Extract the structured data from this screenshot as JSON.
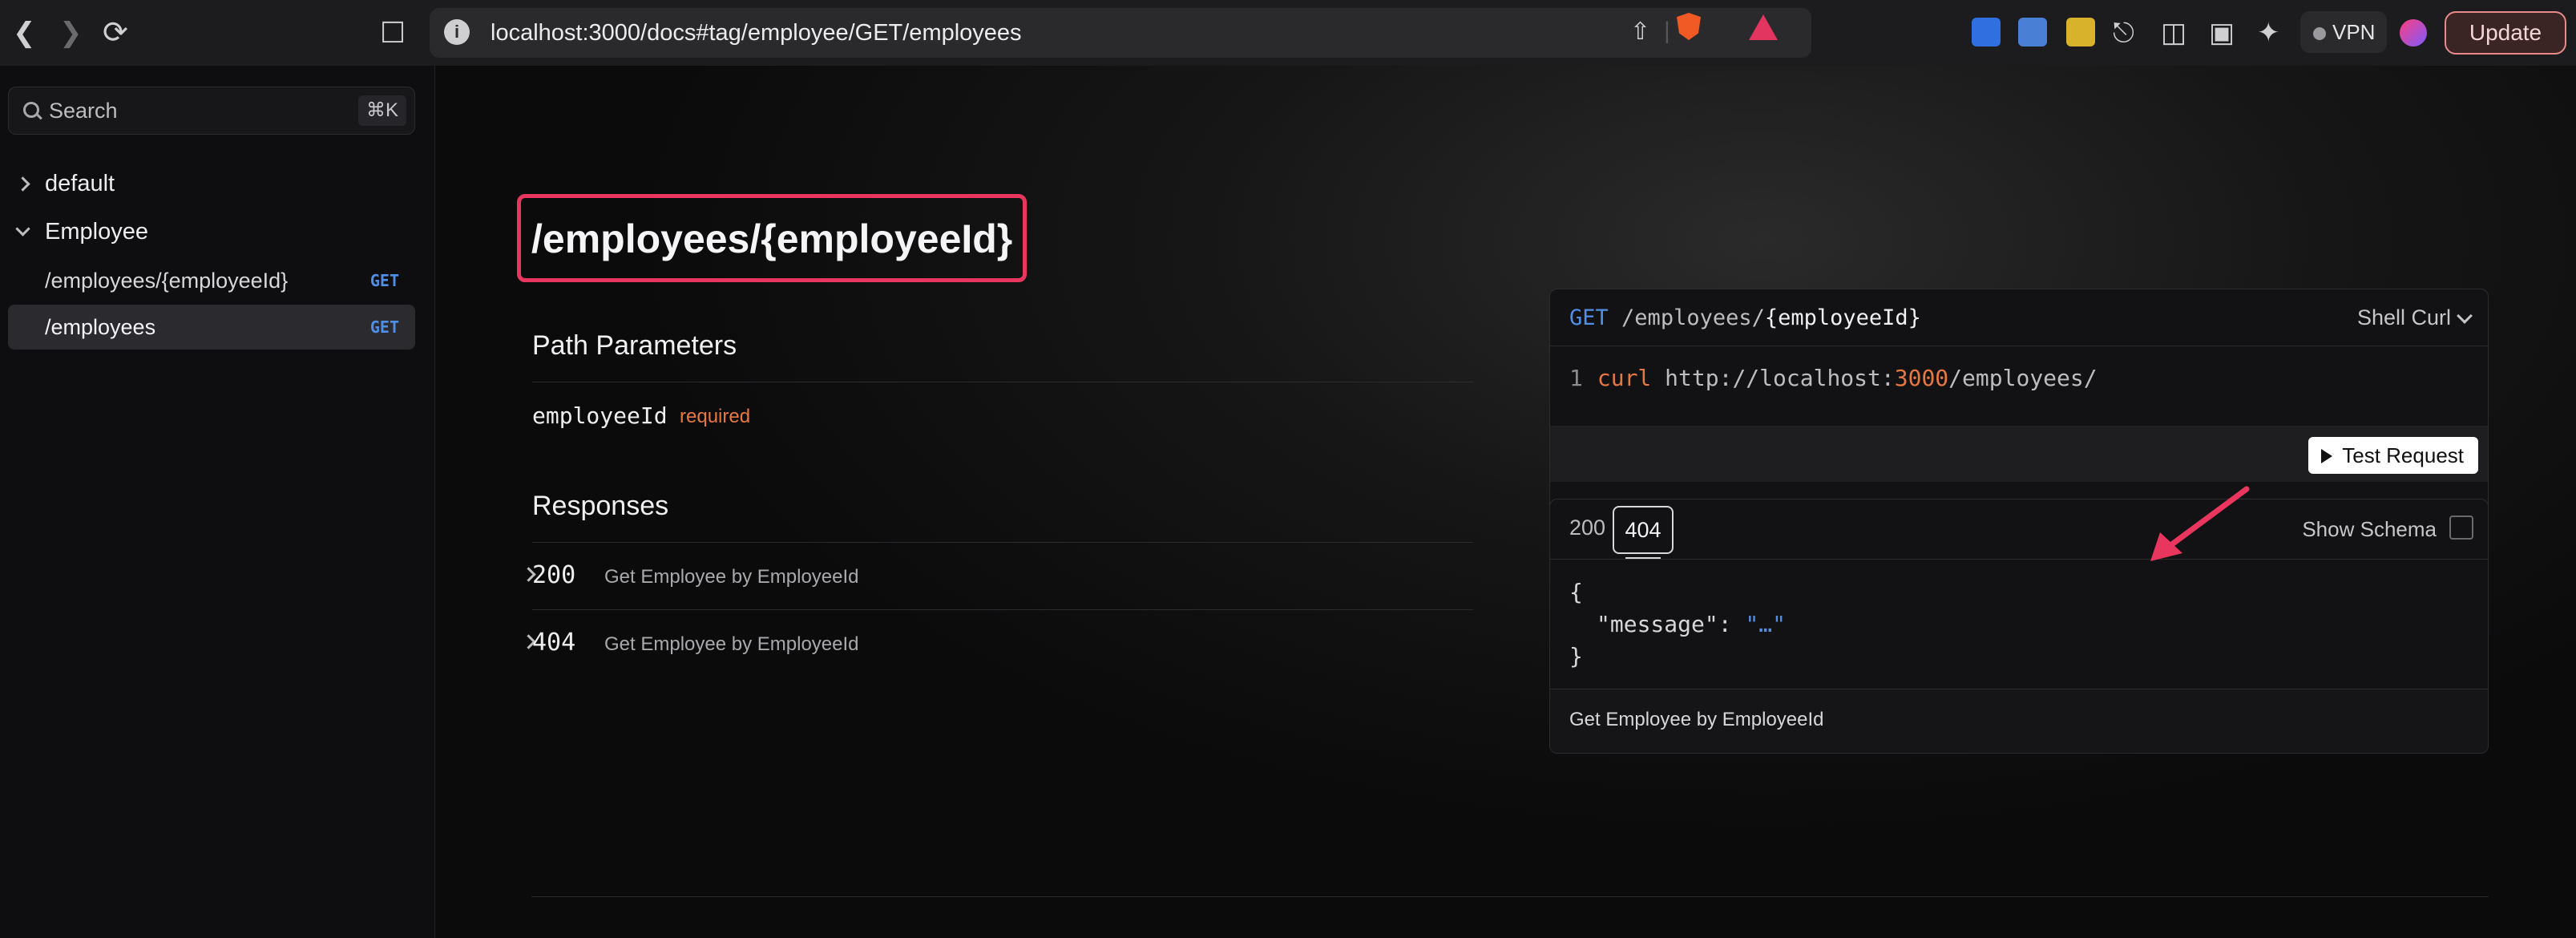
{
  "browser": {
    "url": "localhost:3000/docs#tag/employee/GET/employees",
    "vpn_label": "VPN",
    "update_label": "Update"
  },
  "sidebar": {
    "search_placeholder": "Search",
    "search_shortcut": "⌘K",
    "groups": [
      {
        "label": "default",
        "expanded": false
      },
      {
        "label": "Employee",
        "expanded": true
      }
    ],
    "items": [
      {
        "label": "/employees/{employeeId}",
        "method": "GET",
        "active": false
      },
      {
        "label": "/employees",
        "method": "GET",
        "active": true
      }
    ]
  },
  "main": {
    "title": "/employees/{employeeId}",
    "path_parameters_heading": "Path Parameters",
    "parameter": {
      "name": "employeeId",
      "required_label": "required"
    },
    "responses_heading": "Responses",
    "responses": [
      {
        "code": "200",
        "description": "Get Employee by EmployeeId"
      },
      {
        "code": "404",
        "description": "Get Employee by EmployeeId"
      }
    ]
  },
  "request_card": {
    "method": "GET",
    "path_prefix": "/employees/",
    "path_param": "{employeeId}",
    "language": "Shell Curl",
    "line_number": "1",
    "code_cmd": "curl",
    "code_url_start": "http://localhost:",
    "code_port": "3000",
    "code_url_end": "/employees/",
    "test_button": "Test Request"
  },
  "response_card": {
    "tabs": [
      "200",
      "404"
    ],
    "active_tab": "404",
    "show_schema_label": "Show Schema",
    "json_open": "{",
    "json_key": "\"message\": ",
    "json_value": "\"…\"",
    "json_close": "}",
    "description": "Get Employee by EmployeeId"
  },
  "colors": {
    "accent_method": "#4f8fe6",
    "required": "#e7793f",
    "highlight": "#e8365f"
  }
}
